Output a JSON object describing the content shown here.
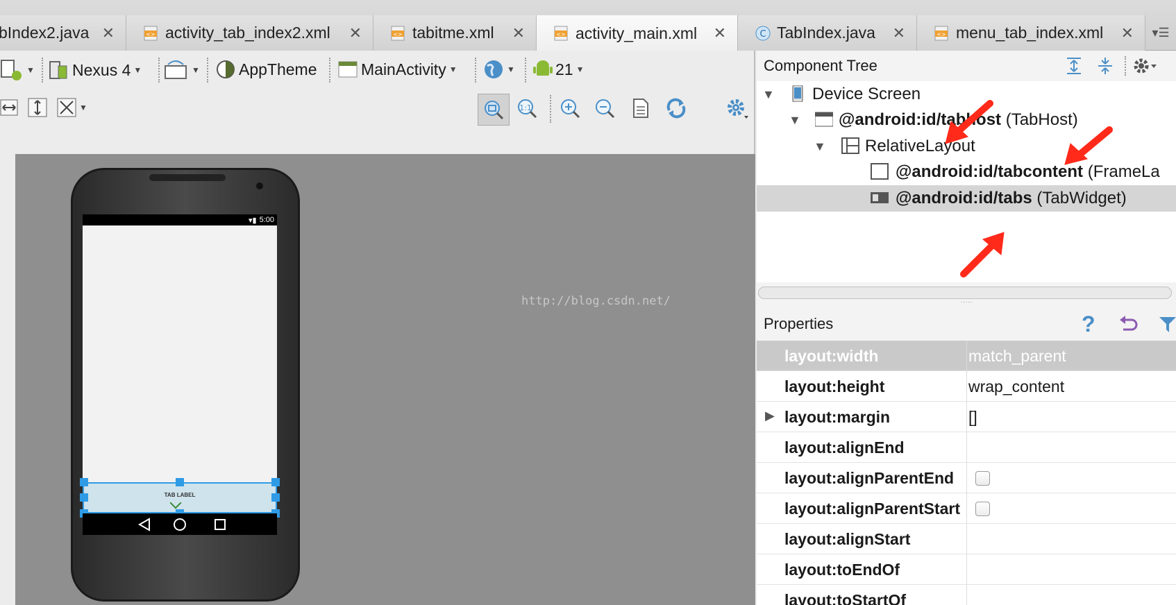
{
  "editor_tabs": [
    {
      "label": "bIndex2.java",
      "icon": "java-file-icon"
    },
    {
      "label": "activity_tab_index2.xml",
      "icon": "xml-file-icon"
    },
    {
      "label": "tabitme.xml",
      "icon": "xml-file-icon"
    },
    {
      "label": "activity_main.xml",
      "icon": "xml-file-icon",
      "active": true
    },
    {
      "label": "TabIndex.java",
      "icon": "class-file-icon"
    },
    {
      "label": "menu_tab_index.xml",
      "icon": "xml-file-icon"
    }
  ],
  "tab_close_glyph": "✕",
  "toolbar": {
    "device": "Nexus 4",
    "theme": "AppTheme",
    "activity": "MainActivity",
    "api_level": "21"
  },
  "preview": {
    "status_time": "5:00",
    "tab_label": "TAB LABEL",
    "watermark": "http://blog.csdn.net/"
  },
  "component_tree": {
    "title": "Component Tree",
    "nodes": [
      {
        "label": "Device Screen",
        "type": ""
      },
      {
        "label": "@android:id/tabhost",
        "type": " (TabHost)"
      },
      {
        "label": "RelativeLayout",
        "type": ""
      },
      {
        "label": "@android:id/tabcontent",
        "type": " (FrameLa"
      },
      {
        "label": "@android:id/tabs",
        "type": " (TabWidget)"
      }
    ]
  },
  "properties": {
    "title": "Properties",
    "help_glyph": "?",
    "rows": [
      {
        "name": "layout:width",
        "value": "match_parent"
      },
      {
        "name": "layout:height",
        "value": "wrap_content"
      },
      {
        "name": "layout:margin",
        "value": "[]"
      },
      {
        "name": "layout:alignEnd",
        "value": ""
      },
      {
        "name": "layout:alignParentEnd",
        "value": ""
      },
      {
        "name": "layout:alignParentStart",
        "value": ""
      },
      {
        "name": "layout:alignStart",
        "value": ""
      },
      {
        "name": "layout:toEndOf",
        "value": ""
      },
      {
        "name": "layout:toStartOf",
        "value": ""
      }
    ]
  },
  "colors": {
    "accent_blue": "#2f9be6",
    "annotation_red": "#ff2a1a",
    "android_green": "#8ab934"
  }
}
